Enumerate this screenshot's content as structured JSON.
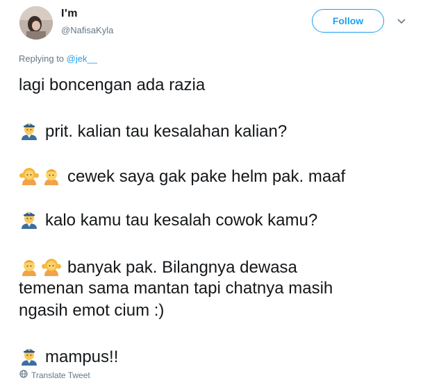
{
  "user": {
    "display_name": "I'm",
    "username": "@NafisaKyla"
  },
  "follow_label": "Follow",
  "reply": {
    "prefix": "Replying to",
    "mention": "@jek__"
  },
  "tweet_lines": [
    "lagi boncengan ada razia",
    "prit. kalian tau kesalahan kalian?",
    "cewek saya gak pake helm pak. maaf",
    "kalo kamu tau kesalah cowok kamu?",
    "banyak pak. Bilangnya dewasa",
    "temenan sama mantan tapi chatnya masih",
    "ngasih emot cium :)",
    "mampus!!"
  ],
  "emojis": {
    "police": "police-officer-emoji",
    "girl": "girl-emoji",
    "boy": "boy-emoji"
  },
  "translate_label": "Translate Tweet",
  "colors": {
    "accent": "#1da1f2",
    "secondary_text": "#657786",
    "primary_text": "#14171a"
  }
}
